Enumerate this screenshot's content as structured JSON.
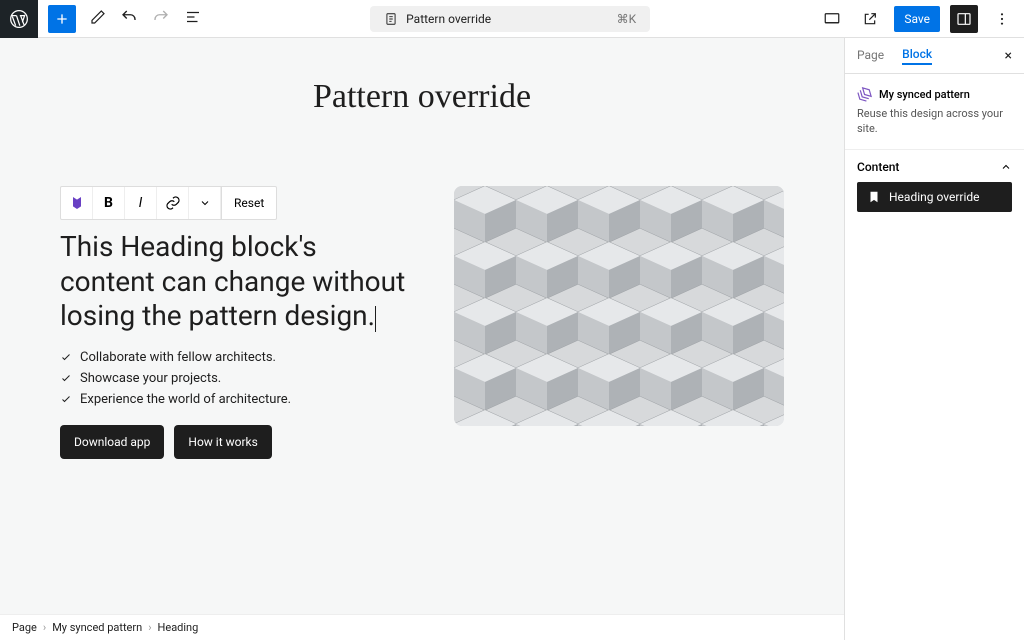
{
  "topbar": {
    "doc_title": "Pattern override",
    "shortcut": "⌘K",
    "save_label": "Save"
  },
  "canvas": {
    "page_title": "Pattern override",
    "toolbar": {
      "reset_label": "Reset"
    },
    "heading_text": "This Heading block's content can change without losing the pattern design.",
    "list_items": [
      "Collaborate with fellow architects.",
      "Showcase your projects.",
      "Experience the world of architecture."
    ],
    "buttons": {
      "primary": "Download app",
      "secondary": "How it works"
    }
  },
  "breadcrumb": {
    "items": [
      "Page",
      "My synced pattern",
      "Heading"
    ]
  },
  "sidebar": {
    "tabs": {
      "page": "Page",
      "block": "Block"
    },
    "block": {
      "name": "My synced pattern",
      "description": "Reuse this design across your site."
    },
    "section_title": "Content",
    "content_item": "Heading override"
  }
}
